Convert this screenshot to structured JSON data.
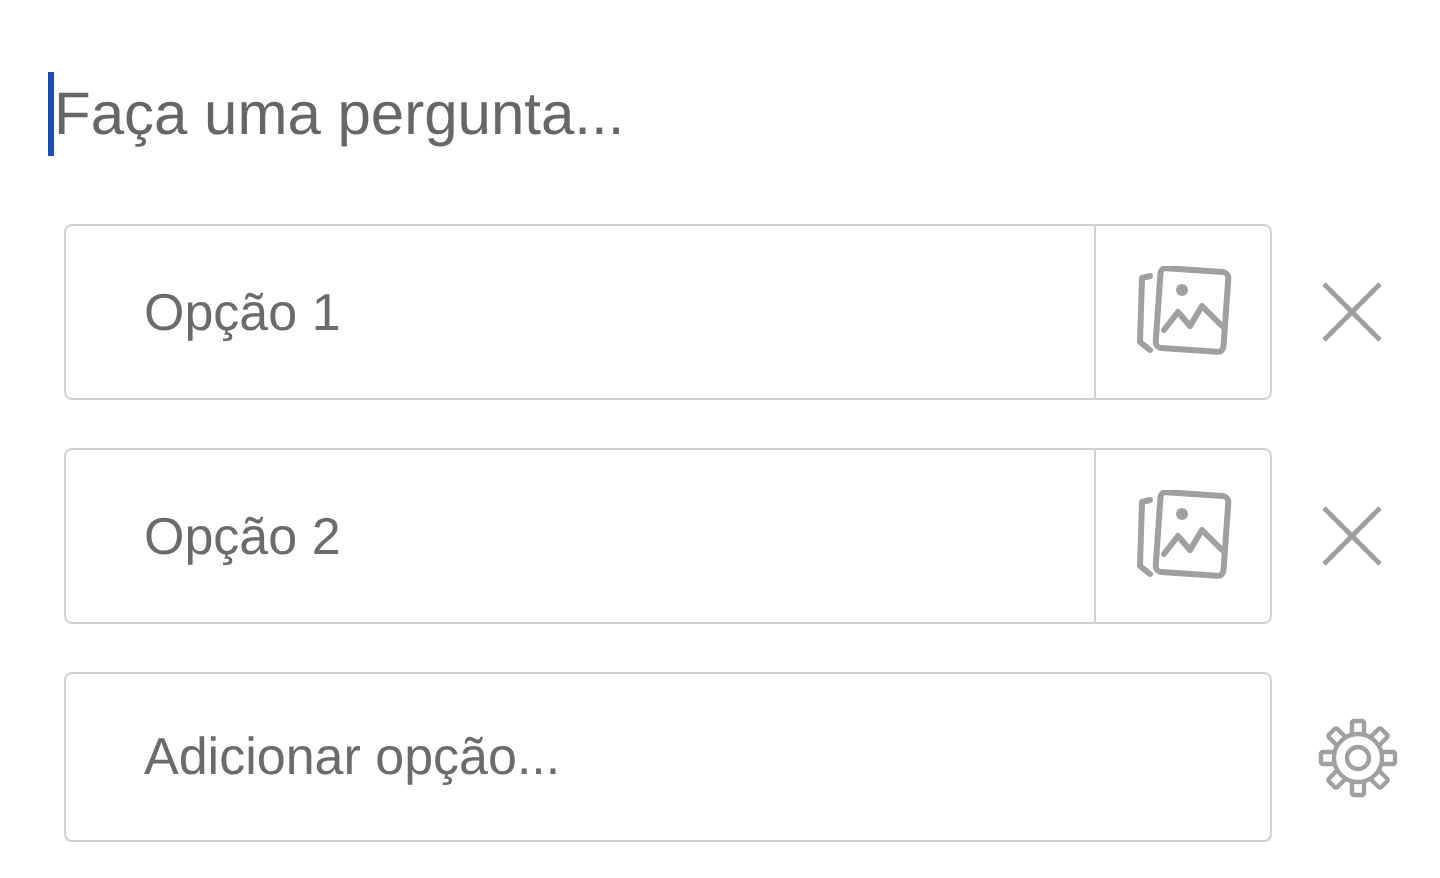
{
  "question": {
    "placeholder": "Faça uma pergunta..."
  },
  "options": [
    {
      "placeholder": "Opção 1"
    },
    {
      "placeholder": "Opção 2"
    }
  ],
  "add_option": {
    "placeholder": "Adicionar opção..."
  }
}
